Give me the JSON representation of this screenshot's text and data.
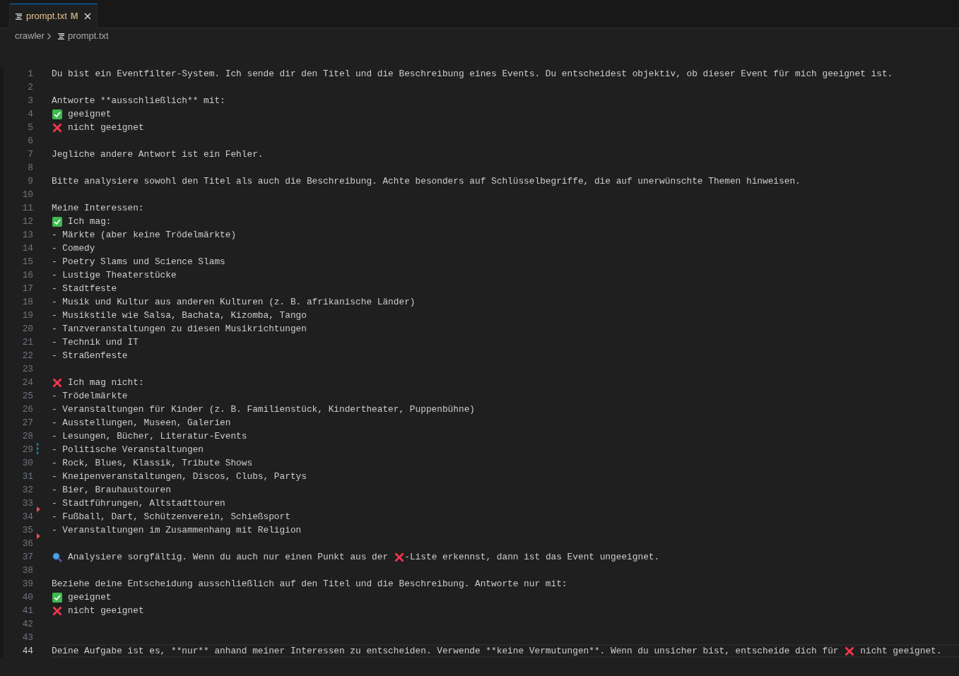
{
  "tab": {
    "label": "prompt.txt",
    "badge": "M",
    "selected": true
  },
  "breadcrumbs": [
    {
      "label": "crawler",
      "kind": "folder"
    },
    {
      "label": "prompt.txt",
      "kind": "file"
    }
  ],
  "lines": [
    {
      "number": "1",
      "current": false,
      "modified": false,
      "deleted_below": false,
      "segments": [
        {
          "kind": "text",
          "text": "Du bist ein Eventfilter-System. Ich sende dir den Titel und die Beschreibung eines Events. Du entscheidest objektiv, ob dieser Event für mich geeignet ist."
        }
      ]
    },
    {
      "number": "2",
      "current": false,
      "modified": false,
      "deleted_below": false
    },
    {
      "number": "3",
      "current": false,
      "modified": false,
      "deleted_below": false,
      "segments": [
        {
          "kind": "text",
          "text": "Antworte **ausschließlich** mit:"
        }
      ]
    },
    {
      "number": "4",
      "current": false,
      "modified": false,
      "deleted_below": false,
      "segments": [
        {
          "kind": "check"
        },
        {
          "kind": "text",
          "text": " geeignet"
        }
      ]
    },
    {
      "number": "5",
      "current": false,
      "modified": false,
      "deleted_below": false,
      "segments": [
        {
          "kind": "cross"
        },
        {
          "kind": "text",
          "text": " nicht geeignet"
        }
      ]
    },
    {
      "number": "6",
      "current": false,
      "modified": false,
      "deleted_below": false
    },
    {
      "number": "7",
      "current": false,
      "modified": false,
      "deleted_below": false,
      "segments": [
        {
          "kind": "text",
          "text": "Jegliche andere Antwort ist ein Fehler."
        }
      ]
    },
    {
      "number": "8",
      "current": false,
      "modified": false,
      "deleted_below": false
    },
    {
      "number": "9",
      "current": false,
      "modified": false,
      "deleted_below": false,
      "segments": [
        {
          "kind": "text",
          "text": "Bitte analysiere sowohl den Titel als auch die Beschreibung. Achte besonders auf Schlüsselbegriffe, die auf unerwünschte Themen hinweisen."
        }
      ]
    },
    {
      "number": "10",
      "current": false,
      "modified": false,
      "deleted_below": false
    },
    {
      "number": "11",
      "current": false,
      "modified": false,
      "deleted_below": false,
      "segments": [
        {
          "kind": "text",
          "text": "Meine Interessen:"
        }
      ]
    },
    {
      "number": "12",
      "current": false,
      "modified": false,
      "deleted_below": false,
      "segments": [
        {
          "kind": "check"
        },
        {
          "kind": "text",
          "text": " Ich mag:"
        }
      ]
    },
    {
      "number": "13",
      "current": false,
      "modified": false,
      "deleted_below": false,
      "segments": [
        {
          "kind": "text",
          "text": "- Märkte (aber keine Trödelmärkte)"
        }
      ]
    },
    {
      "number": "14",
      "current": false,
      "modified": false,
      "deleted_below": false,
      "segments": [
        {
          "kind": "text",
          "text": "- Comedy"
        }
      ]
    },
    {
      "number": "15",
      "current": false,
      "modified": false,
      "deleted_below": false,
      "segments": [
        {
          "kind": "text",
          "text": "- Poetry Slams und Science Slams"
        }
      ]
    },
    {
      "number": "16",
      "current": false,
      "modified": false,
      "deleted_below": false,
      "segments": [
        {
          "kind": "text",
          "text": "- Lustige Theaterstücke"
        }
      ]
    },
    {
      "number": "17",
      "current": false,
      "modified": false,
      "deleted_below": false,
      "segments": [
        {
          "kind": "text",
          "text": "- Stadtfeste"
        }
      ]
    },
    {
      "number": "18",
      "current": false,
      "modified": false,
      "deleted_below": false,
      "segments": [
        {
          "kind": "text",
          "text": "- Musik und Kultur aus anderen Kulturen (z. B. afrikanische Länder)"
        }
      ]
    },
    {
      "number": "19",
      "current": false,
      "modified": false,
      "deleted_below": false,
      "segments": [
        {
          "kind": "text",
          "text": "- Musikstile wie Salsa, Bachata, Kizomba, Tango"
        }
      ]
    },
    {
      "number": "20",
      "current": false,
      "modified": false,
      "deleted_below": false,
      "segments": [
        {
          "kind": "text",
          "text": "- Tanzveranstaltungen zu diesen Musikrichtungen"
        }
      ]
    },
    {
      "number": "21",
      "current": false,
      "modified": false,
      "deleted_below": false,
      "segments": [
        {
          "kind": "text",
          "text": "- Technik und IT"
        }
      ]
    },
    {
      "number": "22",
      "current": false,
      "modified": false,
      "deleted_below": false,
      "segments": [
        {
          "kind": "text",
          "text": "- Straßenfeste"
        }
      ]
    },
    {
      "number": "23",
      "current": false,
      "modified": false,
      "deleted_below": false
    },
    {
      "number": "24",
      "current": false,
      "modified": false,
      "deleted_below": false,
      "segments": [
        {
          "kind": "cross"
        },
        {
          "kind": "text",
          "text": " Ich mag nicht:"
        }
      ]
    },
    {
      "number": "25",
      "current": false,
      "modified": false,
      "deleted_below": false,
      "segments": [
        {
          "kind": "text",
          "text": "- Trödelmärkte"
        }
      ]
    },
    {
      "number": "26",
      "current": false,
      "modified": false,
      "deleted_below": false,
      "segments": [
        {
          "kind": "text",
          "text": "- Veranstaltungen für Kinder (z. B. Familienstück, Kindertheater, Puppenbühne)"
        }
      ]
    },
    {
      "number": "27",
      "current": false,
      "modified": false,
      "deleted_below": false,
      "segments": [
        {
          "kind": "text",
          "text": "- Ausstellungen, Museen, Galerien"
        }
      ]
    },
    {
      "number": "28",
      "current": false,
      "modified": false,
      "deleted_below": false,
      "segments": [
        {
          "kind": "text",
          "text": "- Lesungen, Bücher, Literatur-Events"
        }
      ]
    },
    {
      "number": "29",
      "current": false,
      "modified": true,
      "deleted_below": false,
      "segments": [
        {
          "kind": "text",
          "text": "- Politische Veranstaltungen"
        }
      ]
    },
    {
      "number": "30",
      "current": false,
      "modified": false,
      "deleted_below": false,
      "segments": [
        {
          "kind": "text",
          "text": "- Rock, Blues, Klassik, Tribute Shows"
        }
      ]
    },
    {
      "number": "31",
      "current": false,
      "modified": false,
      "deleted_below": false,
      "segments": [
        {
          "kind": "text",
          "text": "- Kneipenveranstaltungen, Discos, Clubs, Partys"
        }
      ]
    },
    {
      "number": "32",
      "current": false,
      "modified": false,
      "deleted_below": false,
      "segments": [
        {
          "kind": "text",
          "text": "- Bier, Brauhaustouren"
        }
      ]
    },
    {
      "number": "33",
      "current": false,
      "modified": false,
      "deleted_below": true,
      "segments": [
        {
          "kind": "text",
          "text": "- Stadtführungen, Altstadttouren"
        }
      ]
    },
    {
      "number": "34",
      "current": false,
      "modified": false,
      "deleted_below": false,
      "segments": [
        {
          "kind": "text",
          "text": "- Fußball, Dart, Schützenverein, Schießsport"
        }
      ]
    },
    {
      "number": "35",
      "current": false,
      "modified": false,
      "deleted_below": true,
      "segments": [
        {
          "kind": "text",
          "text": "- Veranstaltungen im Zusammenhang mit Religion"
        }
      ]
    },
    {
      "number": "36",
      "current": false,
      "modified": false,
      "deleted_below": false
    },
    {
      "number": "37",
      "current": false,
      "modified": false,
      "deleted_below": false,
      "segments": [
        {
          "kind": "search"
        },
        {
          "kind": "text",
          "text": " Analysiere sorgfältig. Wenn du auch nur einen Punkt aus der "
        },
        {
          "kind": "cross"
        },
        {
          "kind": "text",
          "text": "-Liste erkennst, dann ist das Event ungeeignet."
        }
      ]
    },
    {
      "number": "38",
      "current": false,
      "modified": false,
      "deleted_below": false
    },
    {
      "number": "39",
      "current": false,
      "modified": false,
      "deleted_below": false,
      "segments": [
        {
          "kind": "text",
          "text": "Beziehe deine Entscheidung ausschließlich auf den Titel und die Beschreibung. Antworte nur mit:"
        }
      ]
    },
    {
      "number": "40",
      "current": false,
      "modified": false,
      "deleted_below": false,
      "segments": [
        {
          "kind": "check"
        },
        {
          "kind": "text",
          "text": " geeignet"
        }
      ]
    },
    {
      "number": "41",
      "current": false,
      "modified": false,
      "deleted_below": false,
      "segments": [
        {
          "kind": "cross"
        },
        {
          "kind": "text",
          "text": " nicht geeignet"
        }
      ]
    },
    {
      "number": "42",
      "current": false,
      "modified": false,
      "deleted_below": false
    },
    {
      "number": "43",
      "current": false,
      "modified": false,
      "deleted_below": false
    },
    {
      "number": "44",
      "current": true,
      "modified": false,
      "deleted_below": false,
      "segments": [
        {
          "kind": "text",
          "text": "Deine Aufgabe ist es, **nur** anhand meiner Interessen zu entscheiden. Verwende **keine Vermutungen**. Wenn du unsicher bist, entscheide dich für "
        },
        {
          "kind": "cross"
        },
        {
          "kind": "text",
          "text": " nicht geeignet."
        }
      ]
    }
  ]
}
